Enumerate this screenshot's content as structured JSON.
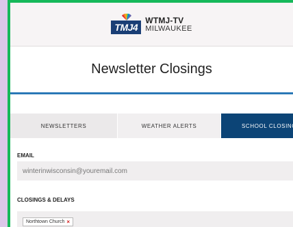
{
  "brand": {
    "logo_text": "TMJ",
    "logo_number": "4",
    "station": "WTMJ-TV",
    "city": "MILWAUKEE"
  },
  "page": {
    "title": "Newsletter Closings"
  },
  "tabs": [
    {
      "label": "NEWSLETTERS",
      "active": false
    },
    {
      "label": "WEATHER ALERTS",
      "active": false
    },
    {
      "label": "SCHOOL CLOSING",
      "active": true
    }
  ],
  "form": {
    "email_label": "EMAIL",
    "email_value": "winterinwisconsin@youremail.com",
    "closings_label": "CLOSINGS & DELAYS",
    "closings_selected": [
      {
        "label": "Northtown Church",
        "remove_glyph": "×"
      }
    ]
  },
  "colors": {
    "active_tab": "#0c4476",
    "accent_rule": "#2a78b6",
    "frame_border": "#16b85a",
    "chip_remove": "#d11c1c"
  }
}
